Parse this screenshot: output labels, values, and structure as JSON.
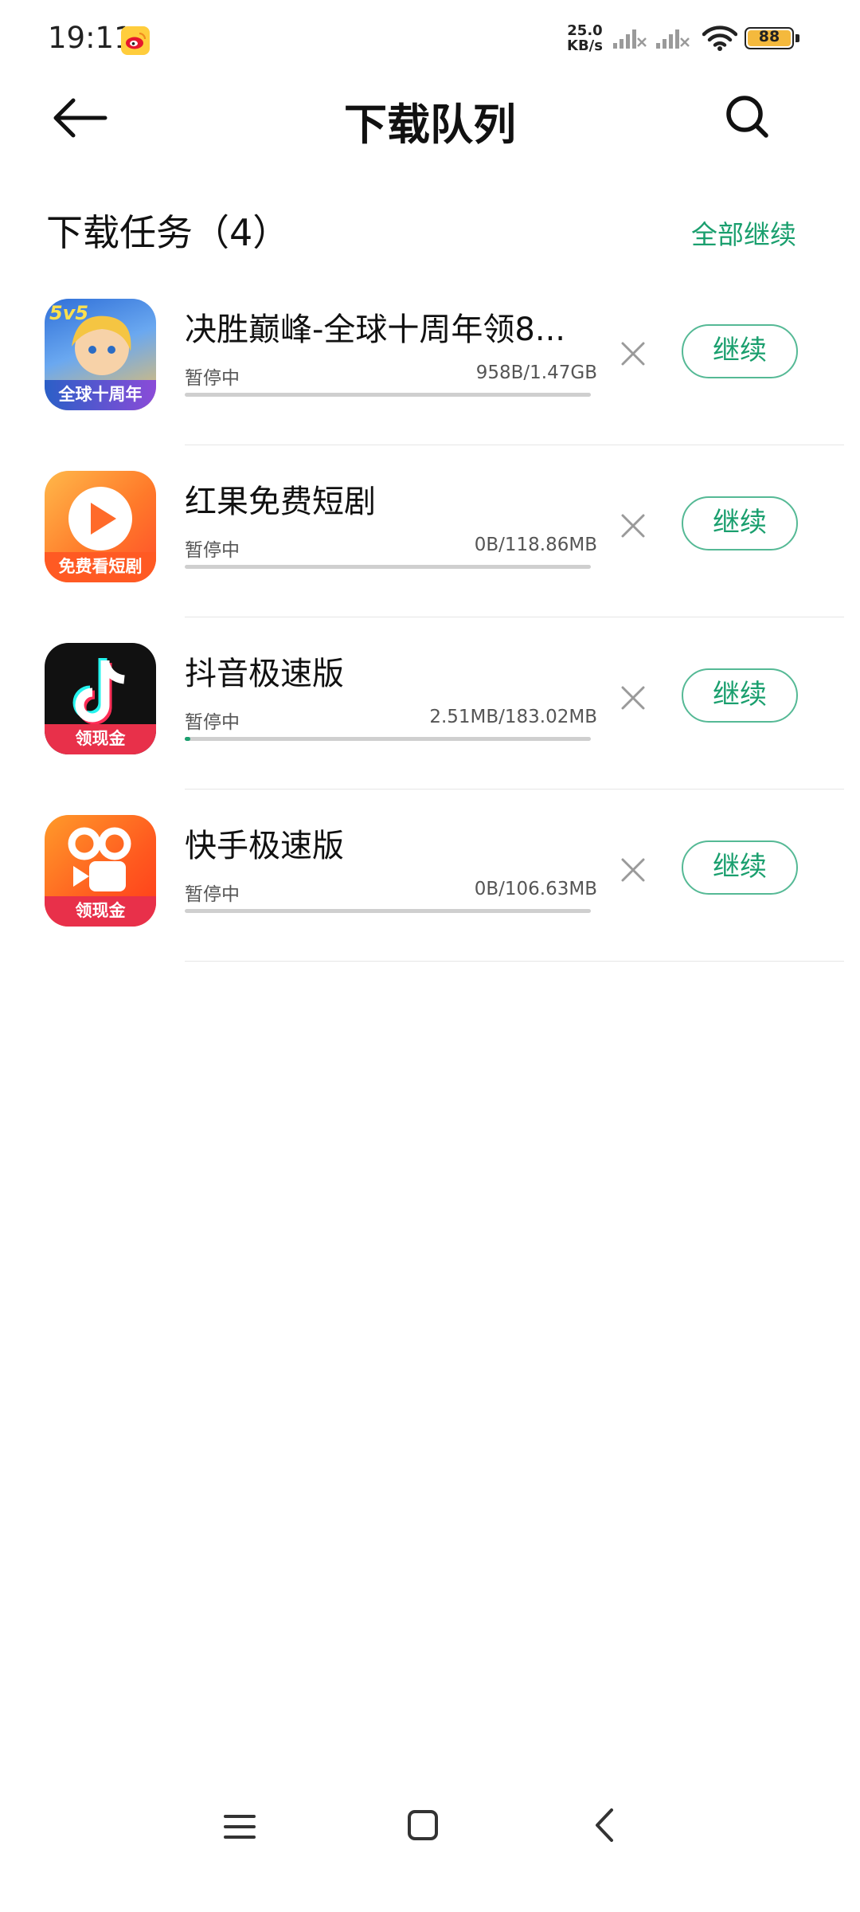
{
  "status_bar": {
    "time": "19:11",
    "net_speed_value": "25.0",
    "net_speed_unit": "KB/s",
    "battery": "88",
    "app_notification_icon": "weibo-icon",
    "colors": {
      "battery_fill": "#f4b93d"
    }
  },
  "header": {
    "title": "下载队列",
    "back_icon": "arrow-left-icon",
    "search_icon": "search-icon"
  },
  "section": {
    "title": "下载任务（4）",
    "resume_all": "全部继续"
  },
  "tasks": [
    {
      "name": "决胜巅峰-全球十周年领8...",
      "status": "暂停中",
      "size": "958B/1.47GB",
      "progress": 0.0,
      "action": "继续",
      "icon": "game-icon",
      "badge": "全球十周年",
      "badge_top": "5v5"
    },
    {
      "name": "红果免费短剧",
      "status": "暂停中",
      "size": "0B/118.86MB",
      "progress": 0.0,
      "action": "继续",
      "icon": "play-icon",
      "badge": "免费看短剧"
    },
    {
      "name": "抖音极速版",
      "status": "暂停中",
      "size": "2.51MB/183.02MB",
      "progress": 0.014,
      "action": "继续",
      "icon": "douyin-icon",
      "badge": "领现金"
    },
    {
      "name": "快手极速版",
      "status": "暂停中",
      "size": "0B/106.63MB",
      "progress": 0.0,
      "action": "继续",
      "icon": "kuaishou-icon",
      "badge": "领现金"
    }
  ],
  "nav": {
    "menu_icon": "menu-icon",
    "home_icon": "home-icon",
    "back_icon": "chevron-left-icon"
  },
  "colors": {
    "accent": "#1a9f6e",
    "accent_border": "#55b995"
  }
}
